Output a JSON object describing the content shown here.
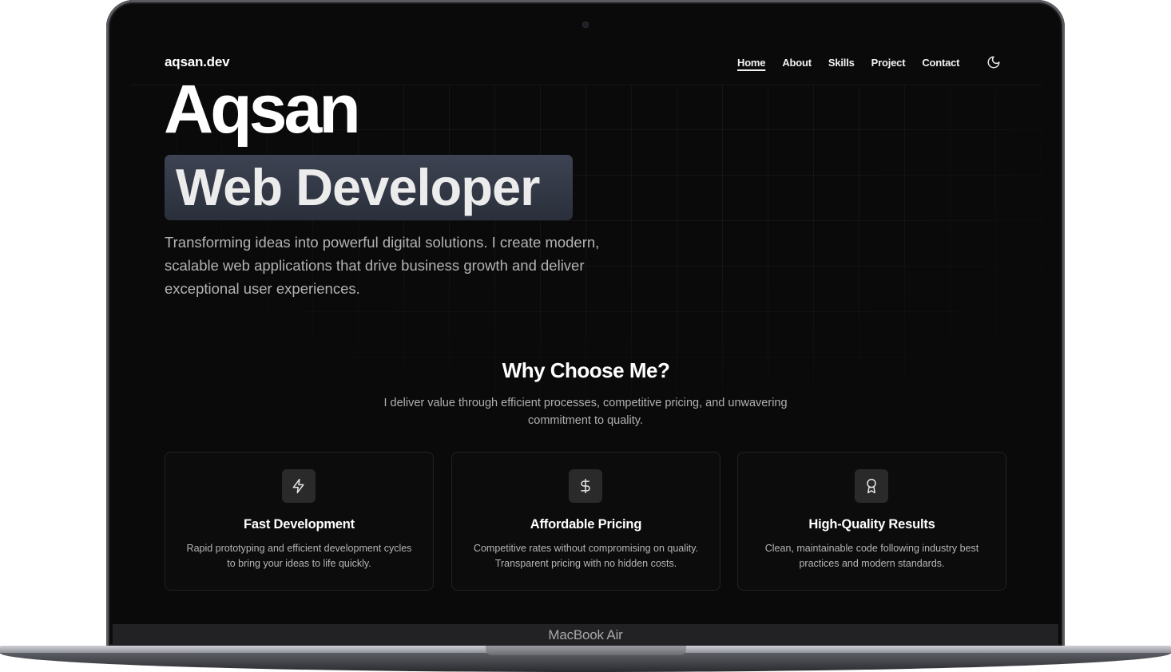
{
  "device": {
    "label": "MacBook Air"
  },
  "navbar": {
    "logo": "aqsan.dev",
    "links": [
      {
        "label": "Home",
        "active": true
      },
      {
        "label": "About"
      },
      {
        "label": "Skills"
      },
      {
        "label": "Project"
      },
      {
        "label": "Contact"
      }
    ],
    "theme_icon": "moon-icon"
  },
  "hero": {
    "name": "Aqsan",
    "role": "Web Developer",
    "description": "Transforming ideas into powerful digital solutions. I create modern, scalable web applications that drive business growth and deliver exceptional user experiences."
  },
  "why": {
    "title": "Why Choose Me?",
    "subtitle": "I deliver value through efficient processes, competitive pricing, and unwavering commitment to quality.",
    "cards": [
      {
        "icon": "lightning-icon",
        "title": "Fast Development",
        "description": "Rapid prototyping and efficient development cycles to bring your ideas to life quickly."
      },
      {
        "icon": "dollar-icon",
        "title": "Affordable Pricing",
        "description": "Competitive rates without compromising on quality. Transparent pricing with no hidden costs."
      },
      {
        "icon": "award-icon",
        "title": "High-Quality Results",
        "description": "Clean, maintainable code following industry best practices and modern standards."
      }
    ]
  },
  "colors": {
    "background": "#0a0a0a",
    "role_highlight": "#333946",
    "card_border": "#222222"
  }
}
